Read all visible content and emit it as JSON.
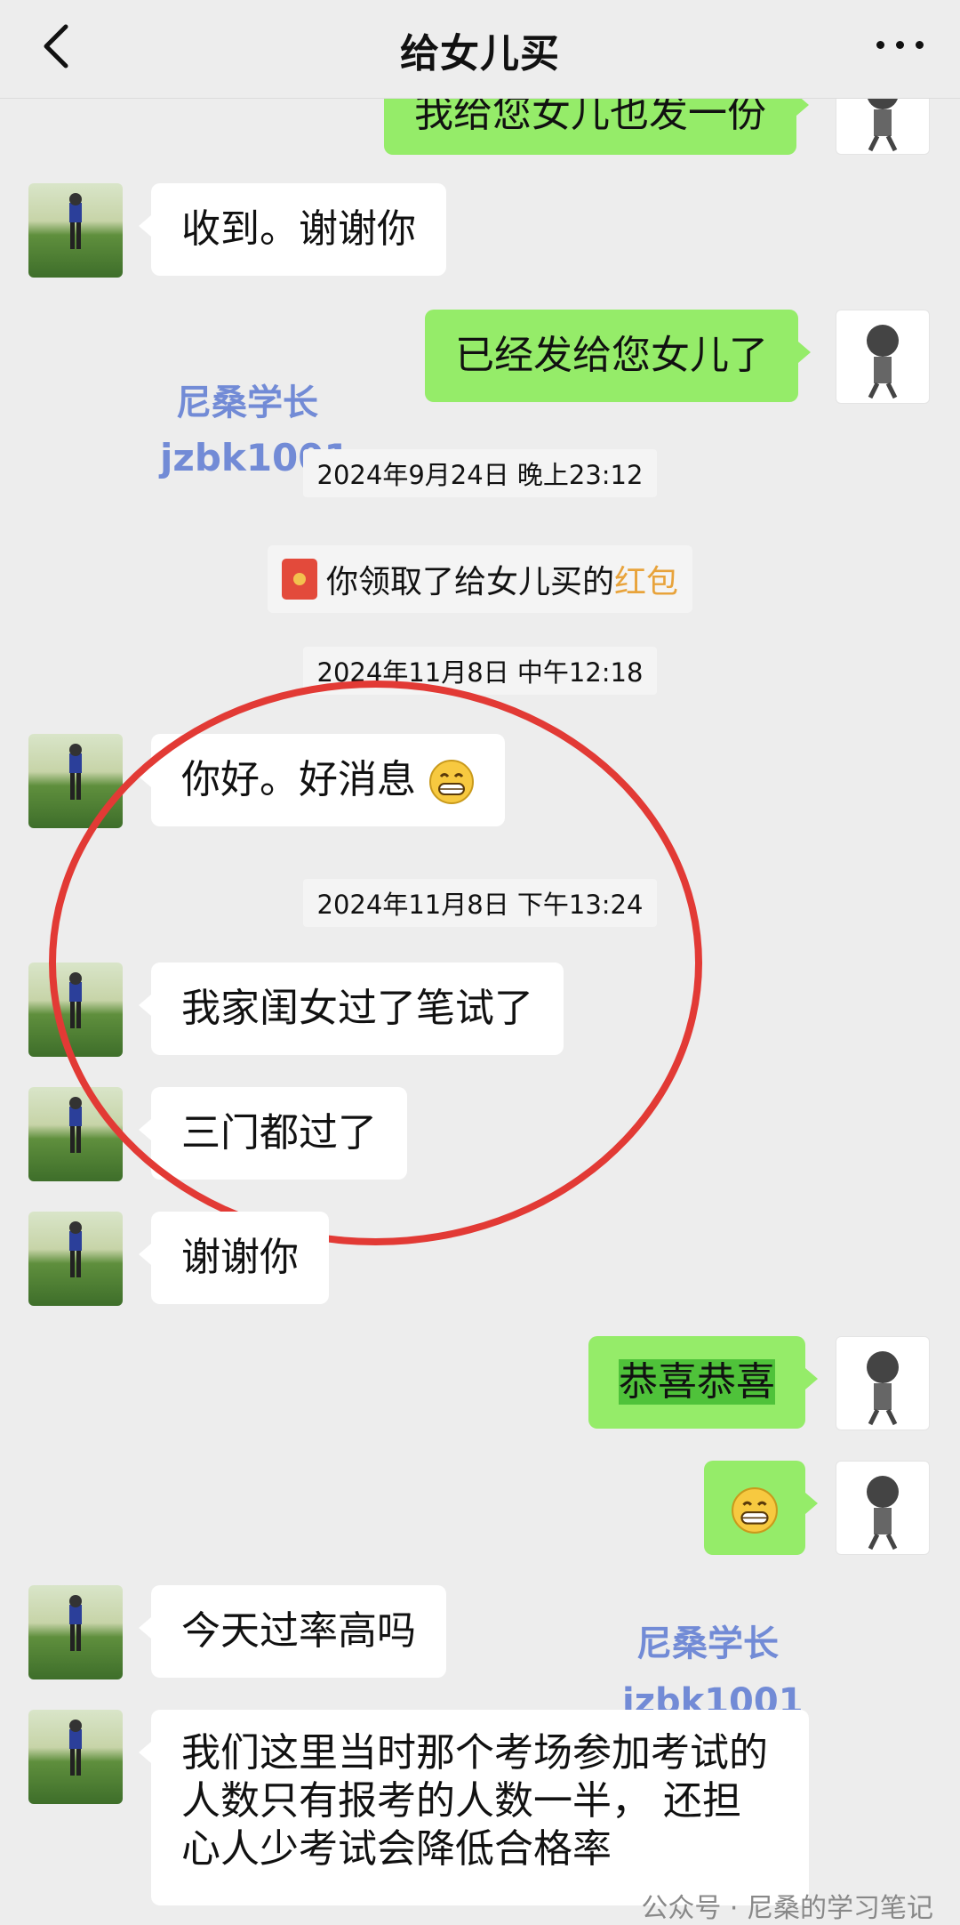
{
  "header": {
    "back_icon": "chevron-left-icon",
    "title": "给女儿买",
    "more_icon": "more-dots-icon"
  },
  "messages": {
    "m0": "我给您女儿也发一份",
    "m1": "收到。谢谢你",
    "m2": "已经发给您女儿了",
    "m4_prefix": "你好。好消息",
    "m5": "我家闺女过了笔试了",
    "m6": "三门都过了",
    "m7": "谢谢你",
    "m8": "恭喜恭喜",
    "m10": "今天过率高吗",
    "m11": "我们这里当时那个考场参加考试的人数只有报考的人数一半， 还担心人少考试会降低合格率"
  },
  "timestamps": {
    "t1": "2024年9月24日 晚上23:12",
    "t2": "2024年11月8日 中午12:18",
    "t3": "2024年11月8日 下午13:24"
  },
  "system": {
    "red_packet_prefix": "你领取了给女儿买的",
    "red_packet_link": "红包"
  },
  "watermark": {
    "name": "尼桑学长",
    "id": "jzbk1001"
  },
  "footer": {
    "text": "公众号 · 尼桑的学习笔记"
  },
  "colors": {
    "outgoing_bubble": "#95ec69",
    "incoming_bubble": "#ffffff",
    "background": "#ededed",
    "annotation_circle": "#e23a35",
    "link": "#e8a33b"
  }
}
